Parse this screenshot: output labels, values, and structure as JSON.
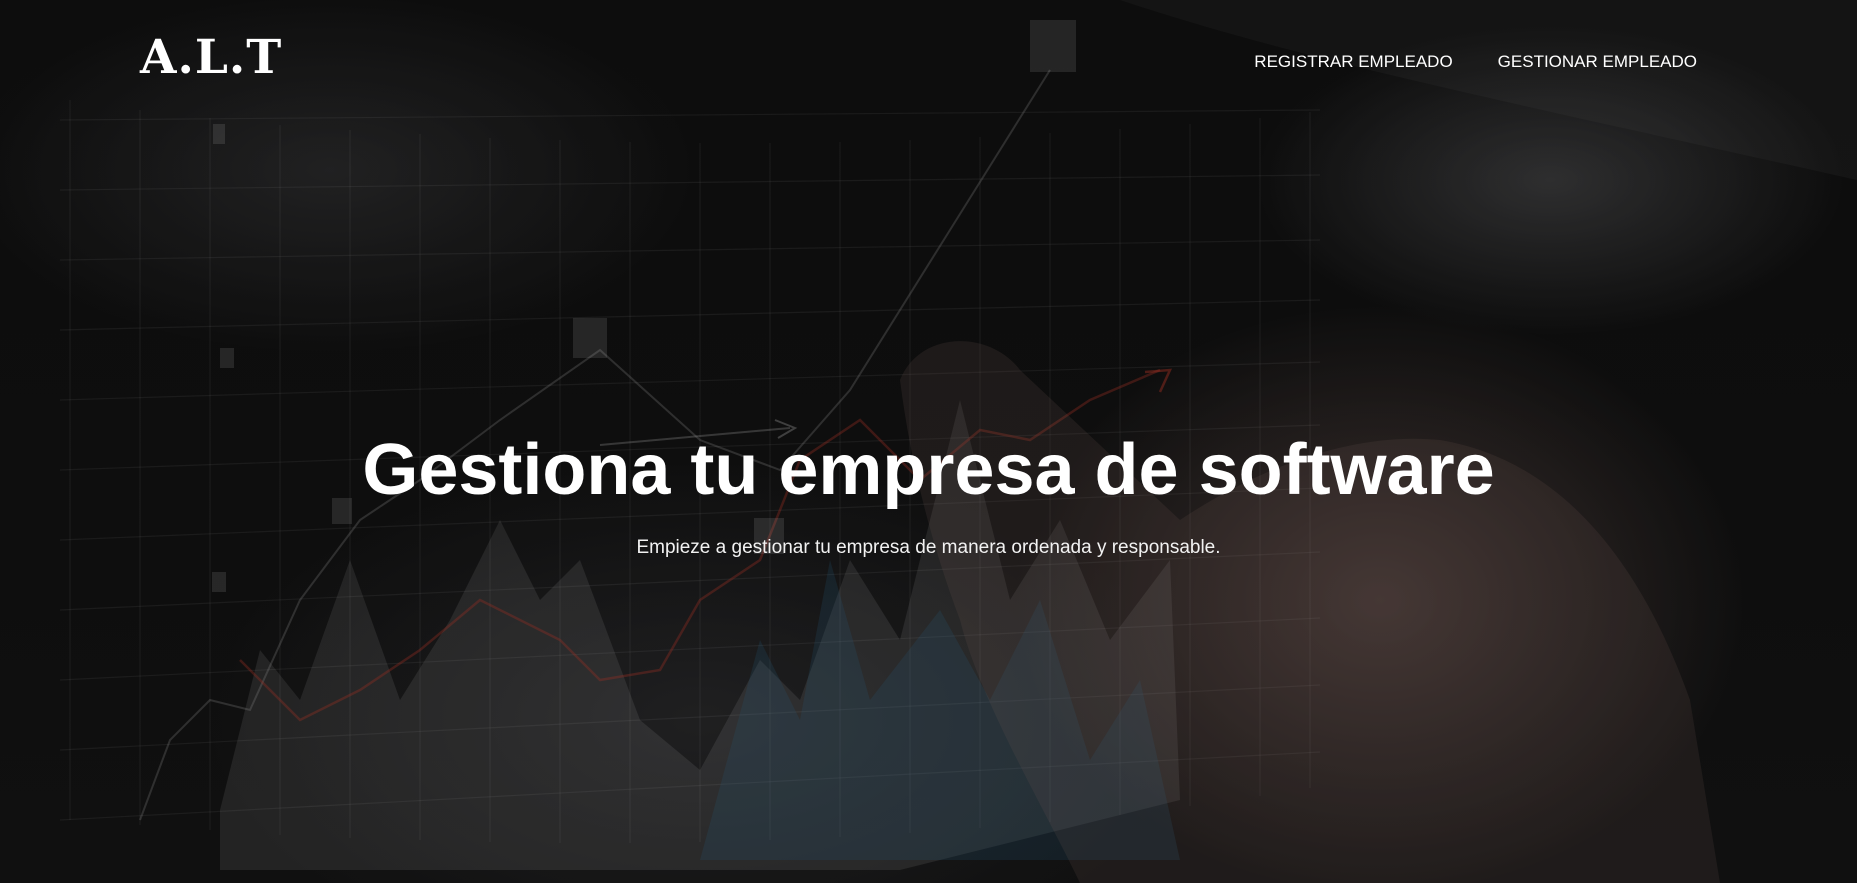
{
  "header": {
    "brand": "A.L.T",
    "nav": [
      {
        "label": "REGISTRAR EMPLEADO"
      },
      {
        "label": "GESTIONAR EMPLEADO"
      }
    ]
  },
  "hero": {
    "title": "Gestiona tu empresa de software",
    "subtitle": "Empieze a gestionar tu empresa de manera ordenada y responsable."
  },
  "colors": {
    "text": "#ffffff",
    "background": "#0b0b0b",
    "accent_red": "#c0392b",
    "accent_blue": "#2e6f96"
  }
}
